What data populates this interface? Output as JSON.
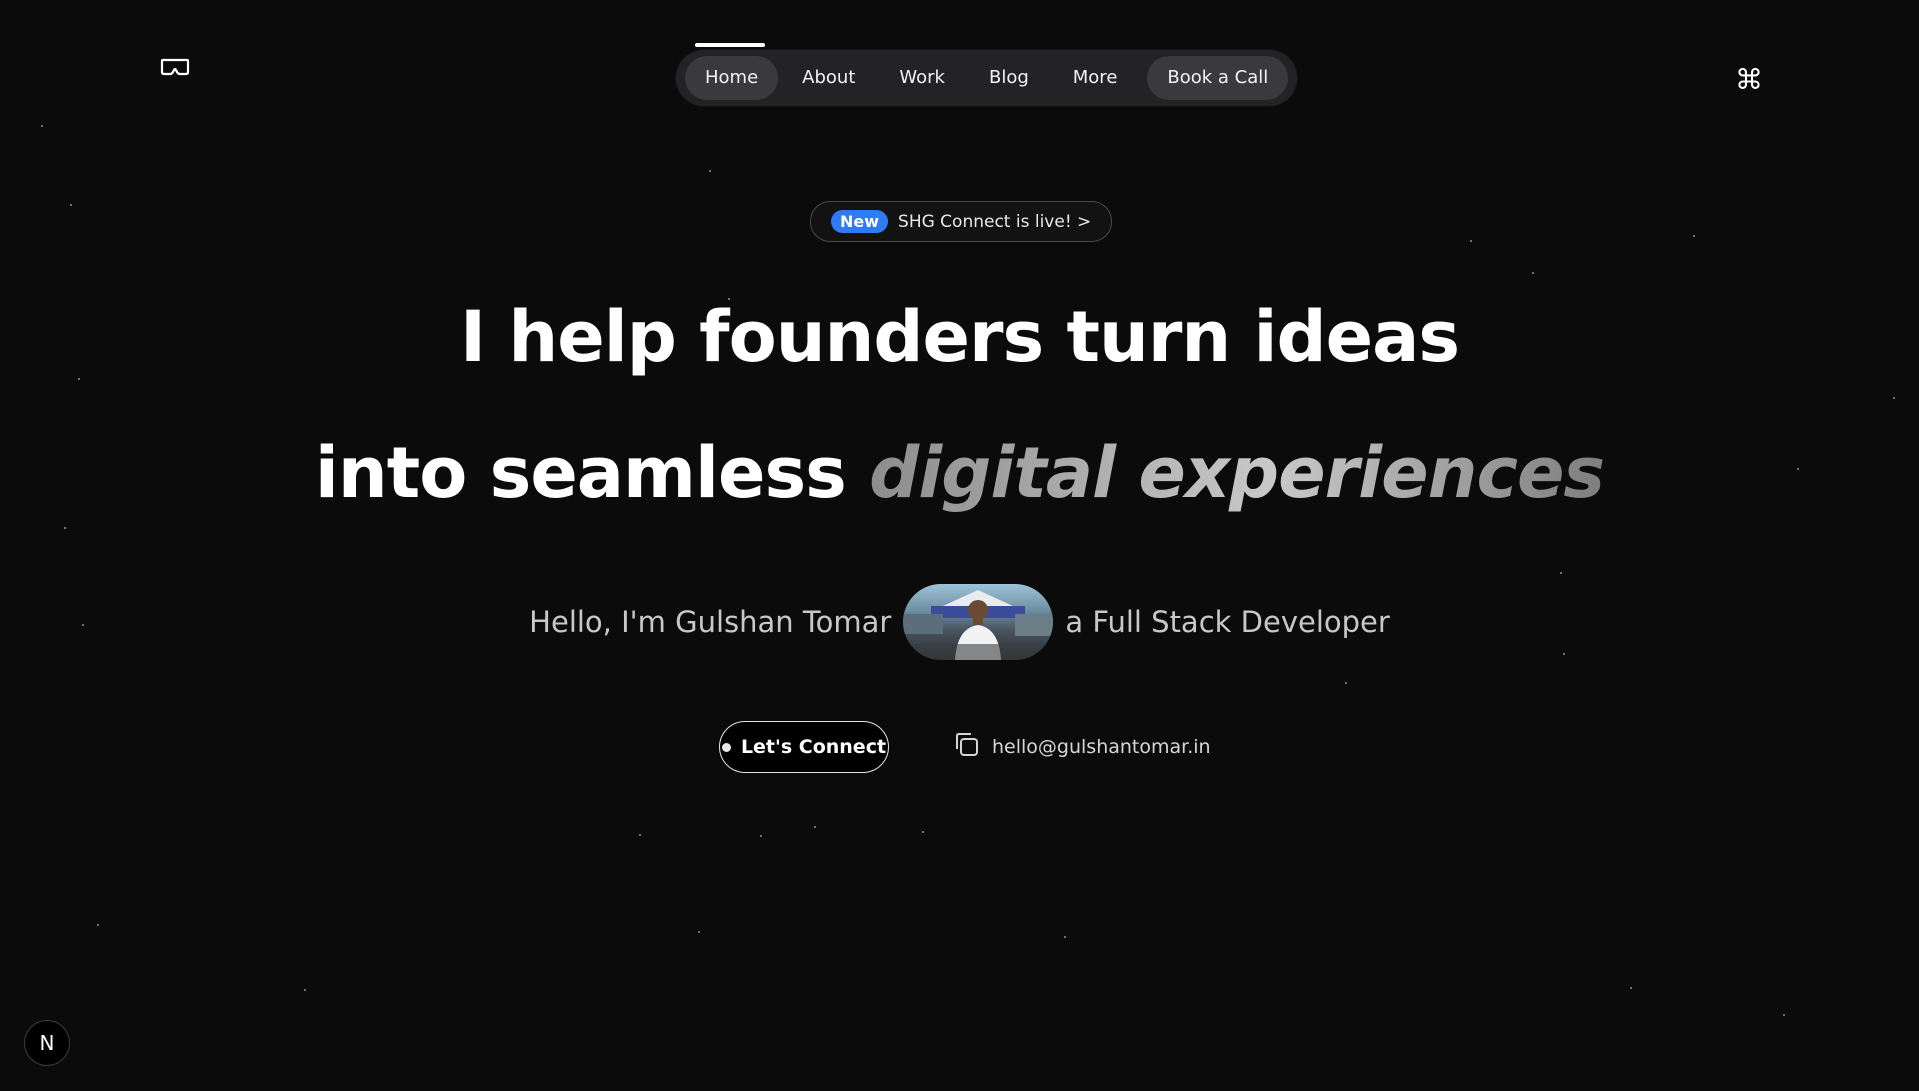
{
  "header": {
    "logo_icon": "vr-headset-icon",
    "nav": [
      {
        "label": "Home",
        "active": true
      },
      {
        "label": "About"
      },
      {
        "label": "Work"
      },
      {
        "label": "Blog"
      },
      {
        "label": "More"
      }
    ],
    "cta_label": "Book a Call",
    "command_icon": "⌘"
  },
  "announcement": {
    "badge": "New",
    "text": "SHG Connect is live! >"
  },
  "hero": {
    "line1": "I help founders turn ideas",
    "line2_plain": "into seamless",
    "line2_accent": "digital experiences"
  },
  "intro": {
    "before": "Hello, I'm Gulshan Tomar",
    "after": "a Full Stack Developer"
  },
  "actions": {
    "connect_label": "Let's Connect",
    "email": "hello@gulshantomar.in"
  },
  "corner_badge": "N",
  "colors": {
    "background": "#0b0b0c",
    "nav_bg": "#232325",
    "badge_blue": "#2f7bf5"
  }
}
